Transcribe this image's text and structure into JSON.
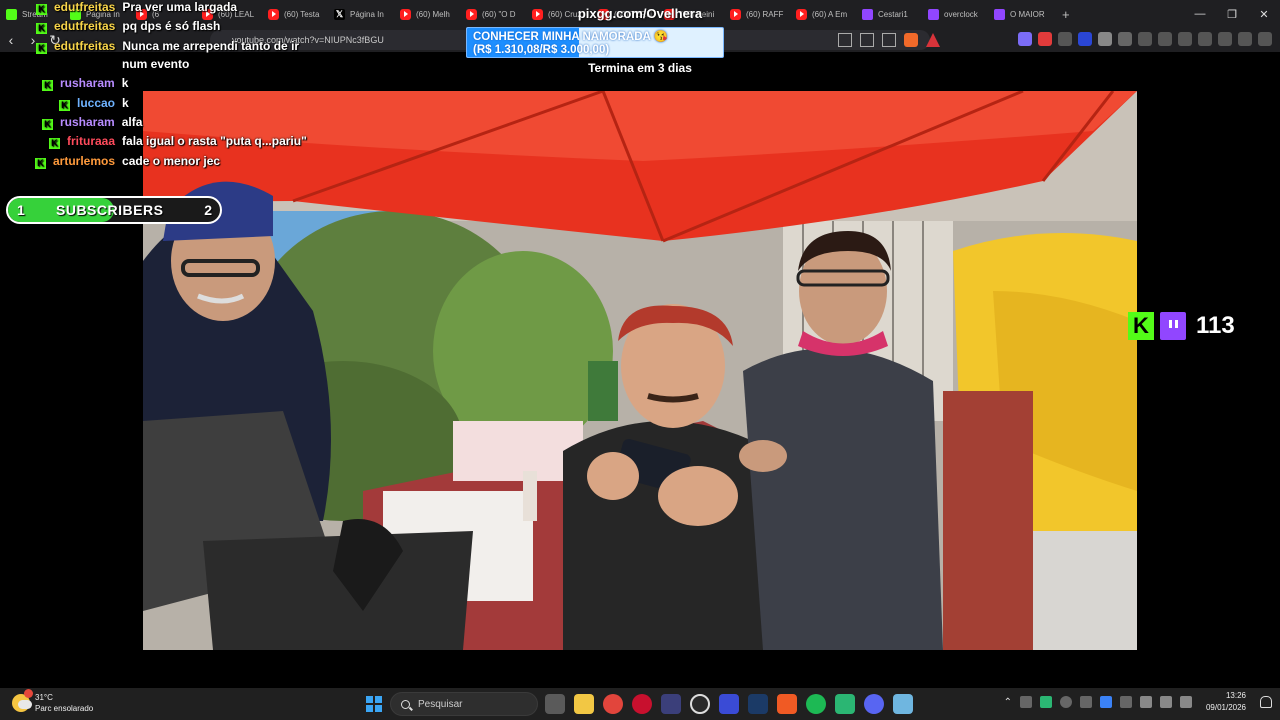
{
  "browser": {
    "tabs": [
      {
        "icon": "kick",
        "label": "Stream"
      },
      {
        "icon": "kick",
        "label": "Página In"
      },
      {
        "icon": "youtube",
        "label": "(6"
      },
      {
        "icon": "youtube",
        "label": "(60) LEAL"
      },
      {
        "icon": "youtube",
        "label": "(60) Testa"
      },
      {
        "icon": "x",
        "label": "Página In"
      },
      {
        "icon": "youtube",
        "label": "(60) Melh"
      },
      {
        "icon": "youtube",
        "label": "(60) \"O D"
      },
      {
        "icon": "youtube",
        "label": "(60) Cruz"
      },
      {
        "icon": "youtube",
        "label": "(60) TERN"
      },
      {
        "icon": "youtube",
        "label": "(60) Keini"
      },
      {
        "icon": "youtube",
        "label": "(60) RAFF"
      },
      {
        "icon": "youtube",
        "label": "(60) A Em"
      },
      {
        "icon": "twitch",
        "label": "Cestari1"
      },
      {
        "icon": "twitch",
        "label": "overclock"
      },
      {
        "icon": "twitch",
        "label": "O MAIOR"
      }
    ],
    "url": "youtube.com/watch?v=NIUPNc3fBGU"
  },
  "chat": {
    "messages": [
      {
        "user": "edutfreitas",
        "color": "#f7d44a",
        "text": "Pra ver uma largada"
      },
      {
        "user": "edutfreitas",
        "color": "#f7d44a",
        "text": "pq dps é só flash"
      },
      {
        "user": "edutfreitas",
        "color": "#f7d44a",
        "text": "Nunca me arrependi tanto de ir"
      },
      {
        "user": "",
        "color": "#f7d44a",
        "text": "num evento"
      },
      {
        "user": "rusharam",
        "color": "#b88cff",
        "text": "k"
      },
      {
        "user": "luccao",
        "color": "#6fb3ff",
        "text": "k"
      },
      {
        "user": "rusharam",
        "color": "#b88cff",
        "text": "alfa"
      },
      {
        "user": "frituraaa",
        "color": "#ff4b5c",
        "text": "fala igual o rasta \"puta q...pariu\""
      },
      {
        "user": "arturlemos",
        "color": "#ff9a3c",
        "text": "cade o menor jec"
      }
    ]
  },
  "subscribers": {
    "current": "1",
    "label": "SUBSCRIBERS",
    "goal": "2",
    "progress": 0.5
  },
  "overlay": {
    "pix_title": "pixgg.com/Ovelhera",
    "goal_title": "CONHECER MINHA NAMORADA 😘",
    "goal_value": "(R$ 1.310,08/R$ 3.000,00)",
    "goal_progress": 0.4367,
    "countdown": "Termina em 3 dias"
  },
  "viewers": {
    "count": "113"
  },
  "taskbar": {
    "weather_temp": "31°C",
    "weather_desc": "Parc ensolarado",
    "search_placeholder": "Pesquisar",
    "time": "13:26",
    "date": "09/01/2026"
  }
}
